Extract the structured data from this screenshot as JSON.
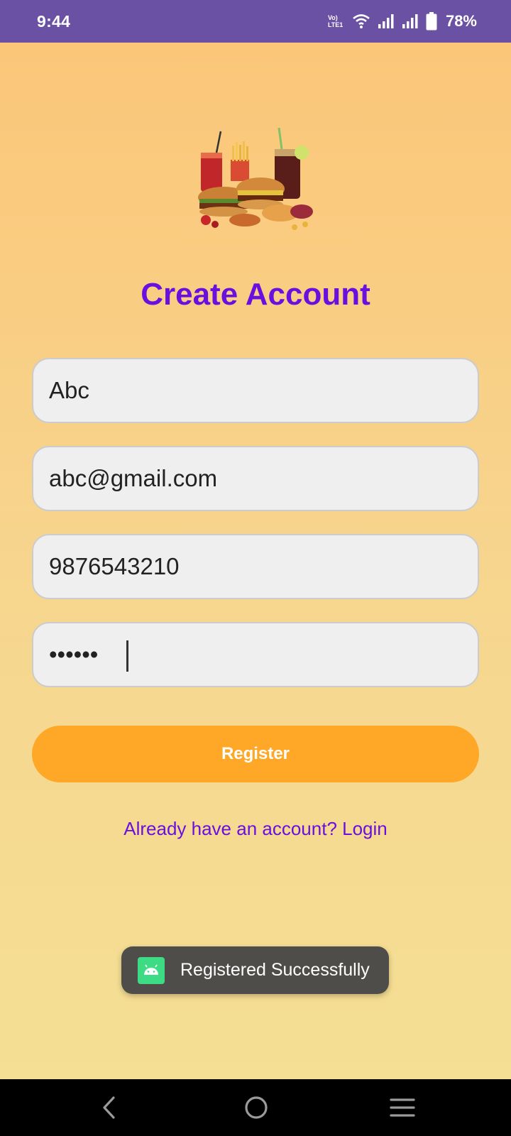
{
  "status_bar": {
    "time": "9:44",
    "volte_top": "Vo)",
    "volte_bottom": "LTE1",
    "battery_percent": "78%"
  },
  "header": {
    "logo_icon": "fast-food-image",
    "title": "Create Account"
  },
  "form": {
    "name_value": "Abc",
    "email_value": "abc@gmail.com",
    "phone_value": "9876543210",
    "password_value": "••••••",
    "register_label": "Register",
    "login_link": "Already have an account? Login"
  },
  "toast": {
    "icon": "android-app-icon",
    "message": "Registered Successfully"
  },
  "nav_bar": {
    "back_icon": "back-icon",
    "home_icon": "home-icon",
    "recents_icon": "recents-icon"
  },
  "colors": {
    "status_bar": "#6a51a4",
    "accent": "#6a0fe0",
    "button": "#ffa726"
  }
}
